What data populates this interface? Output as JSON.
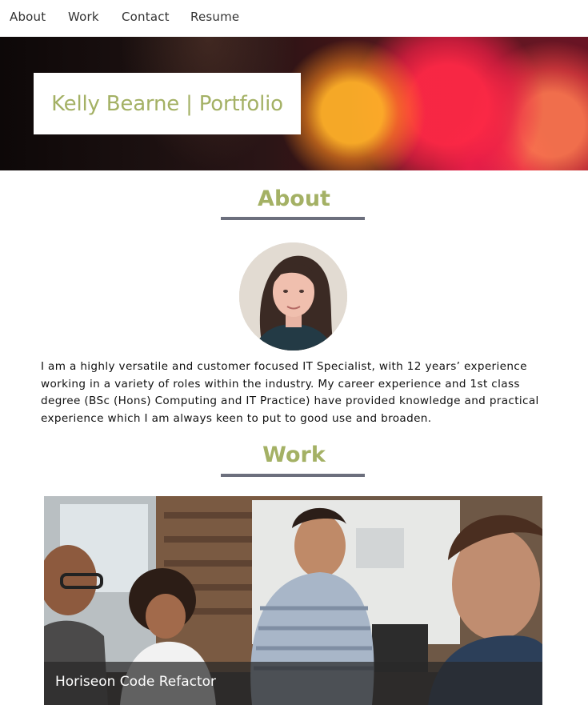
{
  "nav": {
    "items": [
      {
        "label": "About"
      },
      {
        "label": "Work"
      },
      {
        "label": "Contact"
      },
      {
        "label": "Resume"
      }
    ]
  },
  "hero": {
    "title": "Kelly Bearne | Portfolio"
  },
  "about": {
    "heading": "About",
    "avatar_icon": "profile-photo",
    "bio": "I am a highly versatile and customer focused IT Specialist, with 12 years’ experience working in a variety of roles within the industry. My career experience and 1st class degree (BSc (Hons) Computing and IT Practice) have provided knowledge and practical experience which I am always keen to put to good use and broaden."
  },
  "work": {
    "heading": "Work",
    "projects": [
      {
        "title": "Horiseon Code Refactor"
      }
    ]
  },
  "colors": {
    "accent": "#a4b165",
    "divider": "#6c6f7d",
    "nav_text": "#333333"
  }
}
